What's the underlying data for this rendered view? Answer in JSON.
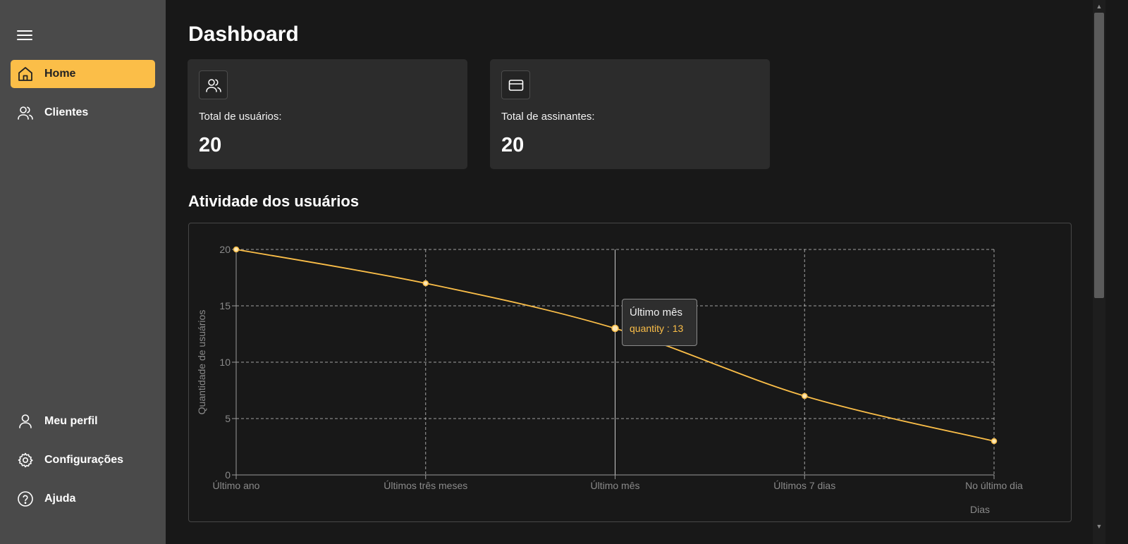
{
  "sidebar": {
    "nav": [
      {
        "label": "Home",
        "icon": "home-icon",
        "active": true
      },
      {
        "label": "Clientes",
        "icon": "users-icon"
      }
    ],
    "bottom_nav": [
      {
        "label": "Meu perfil",
        "icon": "user-icon"
      },
      {
        "label": "Configurações",
        "icon": "gear-icon"
      },
      {
        "label": "Ajuda",
        "icon": "help-circle-icon"
      }
    ]
  },
  "page": {
    "title": "Dashboard"
  },
  "cards": [
    {
      "label": "Total de usuários:",
      "value": "20",
      "icon": "users-icon"
    },
    {
      "label": "Total de assinantes:",
      "value": "20",
      "icon": "credit-card-icon"
    }
  ],
  "activity": {
    "title": "Atividade dos usuários"
  },
  "tooltip": {
    "title": "Último mês",
    "text": "quantity : 13"
  },
  "colors": {
    "accent": "#fbbe48",
    "sidebar": "#4a4a4a",
    "background": "#181818",
    "card": "#2c2c2c"
  },
  "chart_data": {
    "type": "line",
    "categories": [
      "Último ano",
      "Últimos três meses",
      "Último mês",
      "Últimos 7 dias",
      "No último dia"
    ],
    "series": [
      {
        "name": "quantity",
        "values": [
          20,
          17,
          13,
          7,
          3
        ]
      }
    ],
    "xlabel": "Dias",
    "ylabel": "Quantidade de usuários",
    "yticks": [
      "0",
      "5",
      "10",
      "15",
      "20"
    ],
    "ylim": [
      0,
      20
    ],
    "grid": true,
    "highlighted_category": "Último mês"
  }
}
